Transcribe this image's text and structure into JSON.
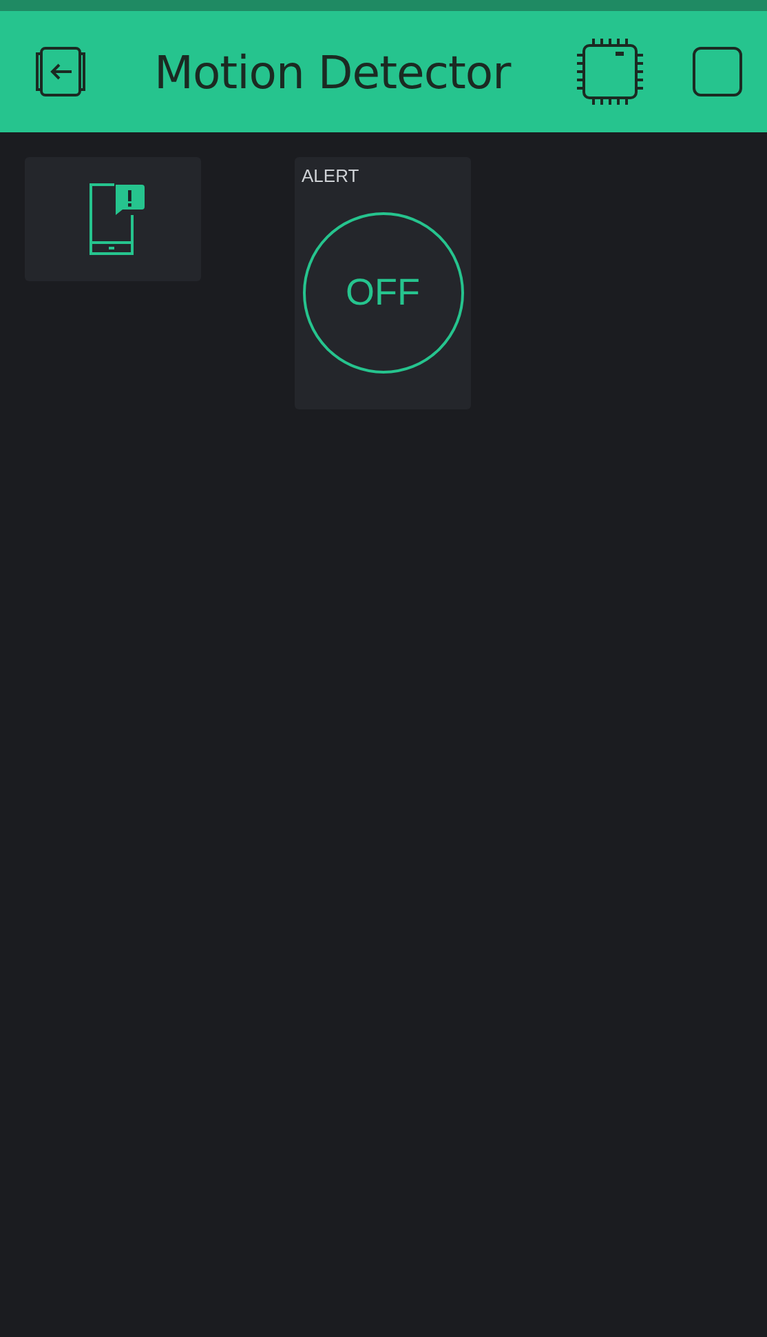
{
  "header": {
    "title": "Motion Detector"
  },
  "widgets": [
    {
      "kind": "notification"
    },
    {
      "kind": "button",
      "label": "ALERT",
      "on": false,
      "state_text": "OFF"
    }
  ]
}
